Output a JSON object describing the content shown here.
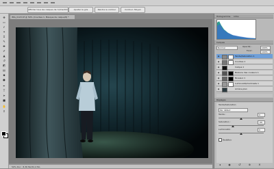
{
  "menubar": {
    "label": ""
  },
  "options_bar": {
    "buttons": [
      "Afficher tous les calques de l'échantillon",
      "Ajuster le gris",
      "Rendre le contour",
      "Contour: Moyen"
    ]
  },
  "toolbox": {
    "tools": [
      "move-icon",
      "marquee-icon",
      "lasso-icon",
      "magic-wand-icon",
      "crop-icon",
      "eyedropper-icon",
      "healing-icon",
      "brush-icon",
      "stamp-icon",
      "history-brush-icon",
      "eraser-icon",
      "gradient-icon",
      "blur-icon",
      "dodge-icon",
      "pen-icon",
      "type-icon",
      "path-select-icon",
      "shape-icon",
      "hand-icon",
      "zoom-icon"
    ],
    "foreground_color": "#000000",
    "background_color": "#ffffff"
  },
  "document": {
    "tab_title": "IMG_0123.tif @ 50% (Courbes 1, Masque de calque/8) *",
    "status_text": "50%   Doc : 8,36 Mo/52,4 Mo"
  },
  "panels": {
    "histogram": {
      "title": "Histogramme",
      "tab2": "Infos"
    },
    "layers": {
      "title": "Calques",
      "blend_mode": "Normal",
      "opacity_label": "Opacité :",
      "opacity_value": "100%",
      "fill_label": "Fond :",
      "fill_value": "100%",
      "items": [
        {
          "name": "Teinte/Saturation 1",
          "selected": true
        },
        {
          "name": "Courbes 1",
          "selected": false
        },
        {
          "name": "Calque 1",
          "selected": false
        },
        {
          "name": "Balance des couleurs 1",
          "selected": false
        },
        {
          "name": "Niveaux 1",
          "selected": false
        },
        {
          "name": "Luminosité/Contraste 1",
          "selected": false
        },
        {
          "name": "Arrière-plan",
          "selected": false
        }
      ]
    },
    "adjustments": {
      "title": "Réglages",
      "subtitle": "Teinte/Saturation",
      "sliders": [
        {
          "label": "Teinte :",
          "value": 0
        },
        {
          "label": "Saturation :",
          "value": -35
        },
        {
          "label": "Luminosité :",
          "value": 0
        }
      ],
      "colorize_label": "Redéfinir"
    }
  },
  "colors": {
    "selected_layer": "#6f9fd8",
    "ui_gray": "#b9b9b9",
    "photo_background": "#050b0d"
  }
}
